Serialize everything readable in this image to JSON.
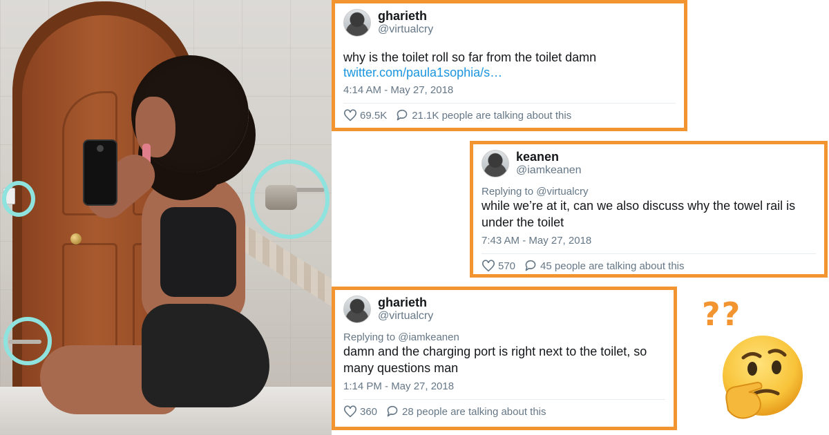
{
  "tweets": [
    {
      "display_name": "gharieth",
      "handle": "@virtualcry",
      "replying_to": "",
      "text": "why is the toilet roll so far from the toilet damn",
      "link": "twitter.com/paula1sophia/s…",
      "timestamp": "4:14 AM - May 27, 2018",
      "likes": "69.5K",
      "talking": "21.1K people are talking about this"
    },
    {
      "display_name": "keanen",
      "handle": "@iamkeanen",
      "replying_to": "Replying to @virtualcry",
      "text": "while we’re at it, can we also discuss why the towel rail is under the toilet",
      "link": "",
      "timestamp": "7:43 AM - May 27, 2018",
      "likes": "570",
      "talking": "45 people are talking about this"
    },
    {
      "display_name": "gharieth",
      "handle": "@virtualcry",
      "replying_to": "Replying to @iamkeanen",
      "text": "damn and the charging port is right next to the toilet, so many questions man",
      "link": "",
      "timestamp": "1:14 PM - May 27, 2018",
      "likes": "360",
      "talking": "28 people are talking about this"
    }
  ],
  "decor": {
    "question_marks": "??",
    "emoji": "thinking-face",
    "accent_color": "#f2942f",
    "ring_color": "#8ee3de",
    "link_color": "#1b95e0"
  }
}
